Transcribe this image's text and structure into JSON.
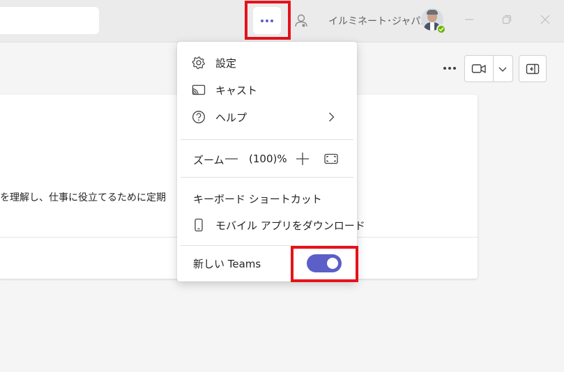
{
  "titlebar": {
    "org_name": "イルミネート･ジャパ...",
    "more_button_label": "•••"
  },
  "card": {
    "text": "を理解し、仕事に役立てるために定期"
  },
  "menu": {
    "settings_label": "設定",
    "cast_label": "キャスト",
    "help_label": "ヘルプ",
    "zoom_label": "ズーム",
    "zoom_value": "(100)%",
    "shortcuts_label": "キーボード ショートカット",
    "mobile_app_label": "モバイル アプリをダウンロード",
    "new_teams_label": "新しい Teams",
    "new_teams_enabled": true
  },
  "colors": {
    "accent": "#5b5fc7",
    "highlight": "#e5121b",
    "presence": "#6bb700"
  },
  "icons": {
    "settings": "gear-icon",
    "cast": "cast-icon",
    "help": "help-circle-icon",
    "mobile": "phone-icon",
    "fit": "fit-screen-icon"
  }
}
